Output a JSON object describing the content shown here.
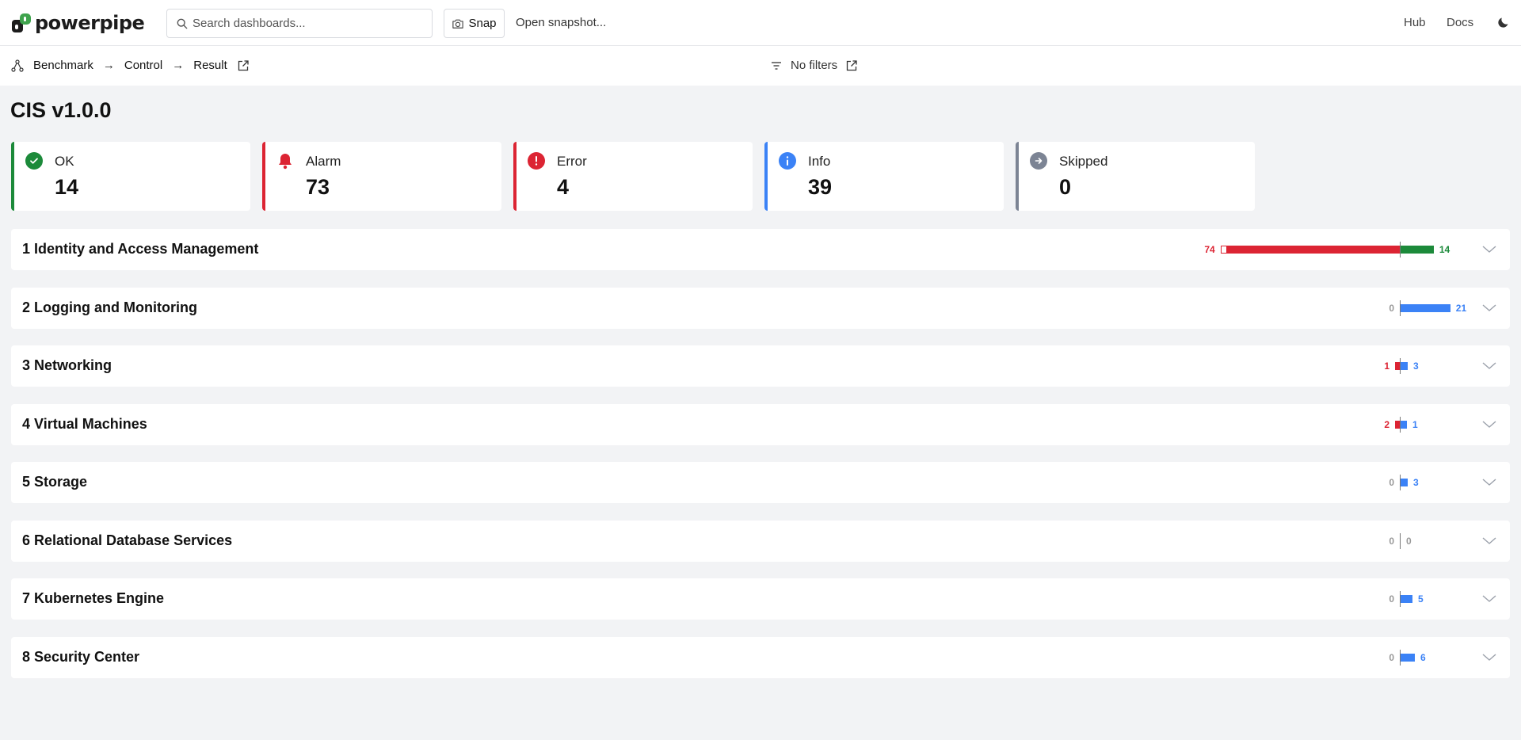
{
  "app": {
    "name": "powerpipe"
  },
  "search": {
    "placeholder": "Search dashboards..."
  },
  "toolbar": {
    "snap_label": "Snap",
    "open_snapshot_label": "Open snapshot..."
  },
  "nav": {
    "hub": "Hub",
    "docs": "Docs"
  },
  "breadcrumb": {
    "items": [
      "Benchmark",
      "Control",
      "Result"
    ],
    "arrow": "→"
  },
  "filters": {
    "label": "No filters"
  },
  "page_title": "CIS v1.0.0",
  "summary": [
    {
      "label": "OK",
      "value": "14",
      "color": "#1c8a3a",
      "icon": "check-circle-icon"
    },
    {
      "label": "Alarm",
      "value": "73",
      "color": "#dc2433",
      "icon": "bell-icon"
    },
    {
      "label": "Error",
      "value": "4",
      "color": "#dc2433",
      "icon": "exclamation-circle-icon"
    },
    {
      "label": "Info",
      "value": "39",
      "color": "#3b82f6",
      "icon": "info-circle-icon"
    },
    {
      "label": "Skipped",
      "value": "0",
      "color": "#7c8494",
      "icon": "arrow-circle-icon"
    }
  ],
  "sections": [
    {
      "title": "1 Identity and Access Management",
      "left_value": "74",
      "left_color": "red",
      "right_value": "14",
      "right_color": "green",
      "alarm": 73,
      "error": 1,
      "ok": 14,
      "info": 0
    },
    {
      "title": "2 Logging and Monitoring",
      "left_value": "0",
      "left_color": "grey",
      "right_value": "21",
      "right_color": "blue",
      "alarm": 0,
      "error": 0,
      "ok": 0,
      "info": 21
    },
    {
      "title": "3 Networking",
      "left_value": "1",
      "left_color": "red",
      "right_value": "3",
      "right_color": "blue",
      "alarm": 1,
      "error": 0,
      "ok": 0,
      "info": 3
    },
    {
      "title": "4 Virtual Machines",
      "left_value": "2",
      "left_color": "red",
      "right_value": "1",
      "right_color": "blue",
      "alarm": 2,
      "error": 0,
      "ok": 0,
      "info": 1
    },
    {
      "title": "5 Storage",
      "left_value": "0",
      "left_color": "grey",
      "right_value": "3",
      "right_color": "blue",
      "alarm": 0,
      "error": 0,
      "ok": 0,
      "info": 3
    },
    {
      "title": "6 Relational Database Services",
      "left_value": "0",
      "left_color": "grey",
      "right_value": "0",
      "right_color": "grey",
      "alarm": 0,
      "error": 0,
      "ok": 0,
      "info": 0
    },
    {
      "title": "7 Kubernetes Engine",
      "left_value": "0",
      "left_color": "grey",
      "right_value": "5",
      "right_color": "blue",
      "alarm": 0,
      "error": 0,
      "ok": 0,
      "info": 5
    },
    {
      "title": "8 Security Center",
      "left_value": "0",
      "left_color": "grey",
      "right_value": "6",
      "right_color": "blue",
      "alarm": 0,
      "error": 0,
      "ok": 0,
      "info": 6
    }
  ],
  "colors": {
    "ok": "#1c8a3a",
    "alarm": "#dc2433",
    "info": "#3b82f6",
    "skipped": "#7c8494"
  }
}
